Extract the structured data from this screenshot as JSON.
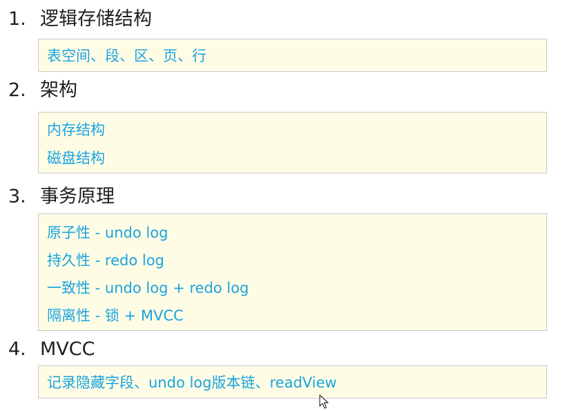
{
  "sections": [
    {
      "number": "1.",
      "title": "逻辑存储结构",
      "lines": [
        "表空间、段、区、页、行"
      ]
    },
    {
      "number": "2.",
      "title": "架构",
      "lines": [
        "内存结构",
        "磁盘结构"
      ]
    },
    {
      "number": "3.",
      "title": "事务原理",
      "lines": [
        "原子性 - undo log",
        "持久性 - redo log",
        "一致性 - undo log + redo log",
        "隔离性 - 锁 + MVCC"
      ]
    },
    {
      "number": "4.",
      "title": "MVCC",
      "lines": [
        "记录隐藏字段、undo log版本链、readView"
      ]
    }
  ],
  "colors": {
    "heading_text": "#1f1f1f",
    "box_text": "#1aa3df",
    "box_background": "#fffce6",
    "box_border": "#c9c9c9"
  },
  "icons": {
    "cursor": "mouse-pointer-icon"
  }
}
